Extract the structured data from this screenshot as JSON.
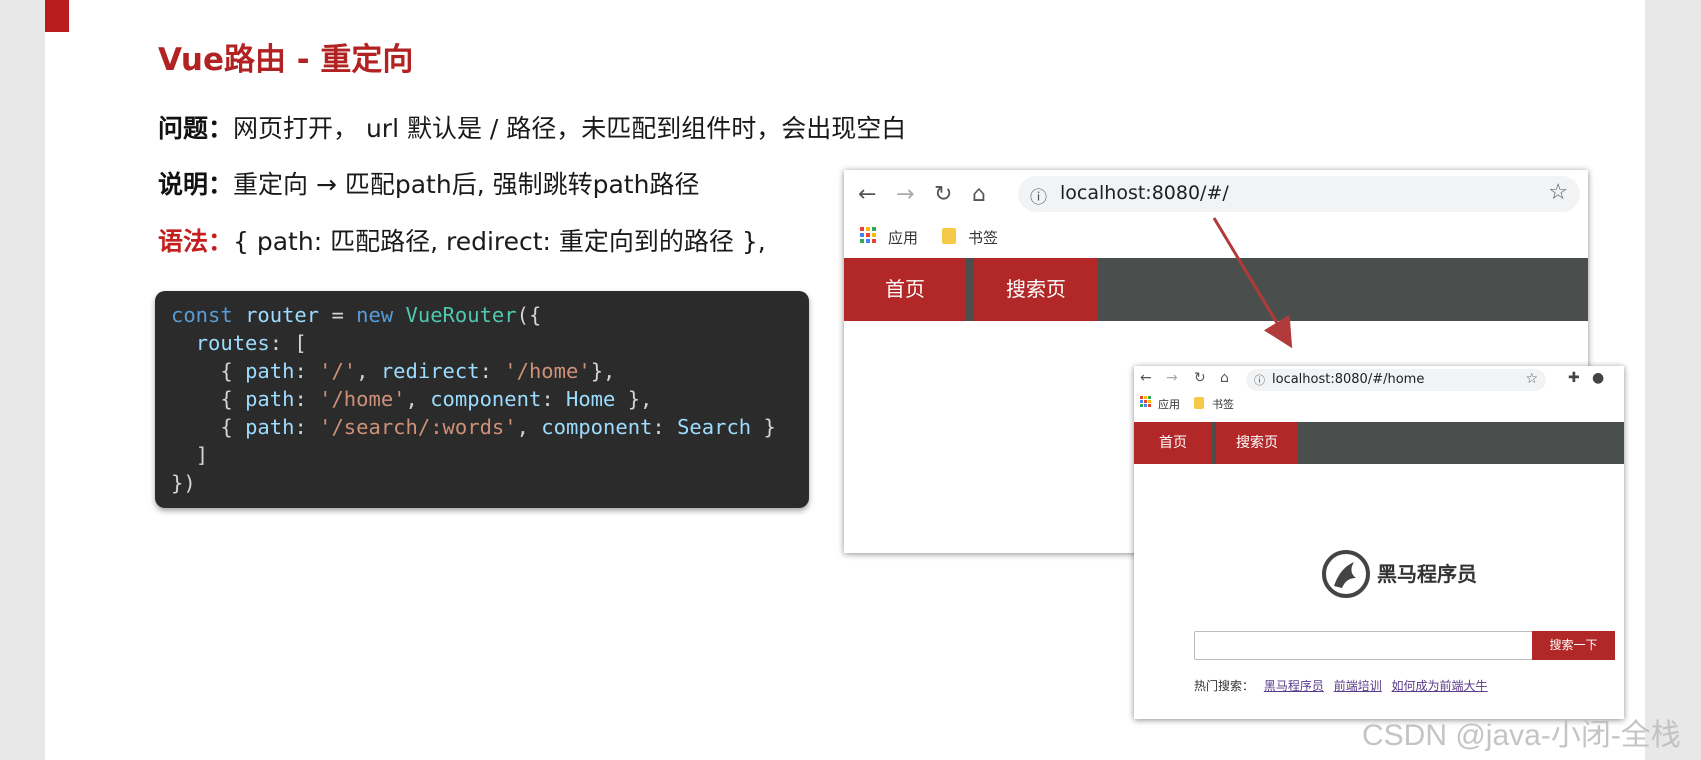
{
  "title": "Vue路由 - 重定向",
  "lines": {
    "problem": {
      "label": "问题：",
      "text": "网页打开， url 默认是 / 路径，未匹配到组件时，会出现空白"
    },
    "explain": {
      "label": "说明：",
      "text": "重定向 → 匹配path后, 强制跳转path路径"
    },
    "syntax": {
      "label": "语法：",
      "text": "{ path: 匹配路径, redirect: 重定向到的路径 },"
    }
  },
  "code": {
    "kw_const": "const",
    "var_router": "router",
    "eq": " = ",
    "kw_new": "new",
    "cls_router": "VueRouter",
    "open": "({",
    "routes_key": "routes",
    "routes_open": ": [",
    "r1_open": "{ ",
    "path_key": "path",
    "colon": ": ",
    "r1_path": "'/'",
    "comma_sp": ", ",
    "redirect_key": "redirect",
    "r1_redirect": "'/home'",
    "r1_close": "},",
    "r2_path": "'/home'",
    "component_key": "component",
    "r2_comp": "Home",
    "r2_close": " },",
    "r3_path": "'/search/:words'",
    "r3_comp": "Search",
    "r3_close": " }",
    "routes_close": "]",
    "close": "})"
  },
  "browser1": {
    "url": "localhost:8080/#/",
    "bookmark_apps": "应用",
    "bookmark_folder": "书签",
    "tabs": [
      "首页",
      "搜索页"
    ]
  },
  "browser2": {
    "url": "localhost:8080/#/home",
    "bookmark_apps": "应用",
    "bookmark_folder": "书签",
    "tabs": [
      "首页",
      "搜索页"
    ],
    "logo_text": "黑马程序员",
    "search_button": "搜索一下",
    "hot_label": "热门搜索：",
    "hot_links": [
      "黑马程序员",
      "前端培训",
      "如何成为前端大牛"
    ]
  },
  "watermark": "CSDN @java-小闭-全栈",
  "colors": {
    "accent": "#b22727",
    "navbar": "#4a4f4e",
    "code_bg": "#2b2b2b"
  },
  "icons": [
    "back-arrow-icon",
    "forward-arrow-icon",
    "reload-icon",
    "home-icon",
    "info-icon",
    "star-icon",
    "apps-grid-icon",
    "folder-icon",
    "puzzle-icon",
    "profile-icon"
  ]
}
